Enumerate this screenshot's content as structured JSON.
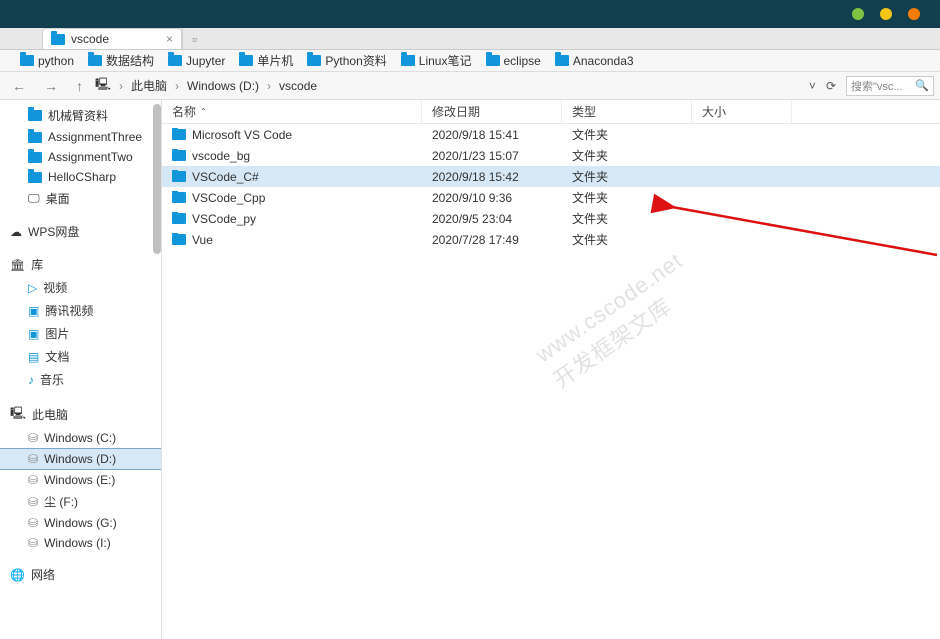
{
  "tab": {
    "title": "vscode"
  },
  "bookmarks": [
    "python",
    "数据结构",
    "Jupyter",
    "单片机",
    "Python资料",
    "Linux笔记",
    "eclipse",
    "Anaconda3"
  ],
  "breadcrumb": {
    "root": "此电脑",
    "crumbs": [
      "Windows (D:)",
      "vscode"
    ]
  },
  "search": {
    "placeholder": "搜索\"vsc..."
  },
  "sidebar": {
    "favs": [
      "机械臂资料",
      "AssignmentThree",
      "AssignmentTwo",
      "HelloCSharp",
      "桌面"
    ],
    "wps": "WPS网盘",
    "lib": {
      "label": "库",
      "items": [
        "视频",
        "腾讯视频",
        "图片",
        "文档",
        "音乐"
      ]
    },
    "pc": {
      "label": "此电脑",
      "drives": [
        "Windows (C:)",
        "Windows (D:)",
        "Windows (E:)",
        "尘 (F:)",
        "Windows (G:)",
        "Windows (I:)"
      ],
      "selected": 1
    },
    "net": "网络"
  },
  "columns": {
    "name": "名称",
    "date": "修改日期",
    "type": "类型",
    "size": "大小"
  },
  "rows": [
    {
      "name": "Microsoft VS Code",
      "date": "2020/9/18 15:41",
      "type": "文件夹"
    },
    {
      "name": "vscode_bg",
      "date": "2020/1/23 15:07",
      "type": "文件夹"
    },
    {
      "name": "VSCode_C#",
      "date": "2020/9/18 15:42",
      "type": "文件夹",
      "selected": true
    },
    {
      "name": "VSCode_Cpp",
      "date": "2020/9/10 9:36",
      "type": "文件夹"
    },
    {
      "name": "VSCode_py",
      "date": "2020/9/5 23:04",
      "type": "文件夹"
    },
    {
      "name": "Vue",
      "date": "2020/7/28 17:49",
      "type": "文件夹"
    }
  ],
  "watermark": {
    "line1": "www.cscode.net",
    "line2": "开发框架文库"
  },
  "icons": {
    "video": "▷",
    "tencent": "▣",
    "picture": "▣",
    "doc": "▤",
    "music": "♪",
    "cloud": "☁",
    "lib": "🏛",
    "pc": "🖳",
    "disk": "⛁",
    "net": "🌐",
    "desktop": "🖵"
  }
}
